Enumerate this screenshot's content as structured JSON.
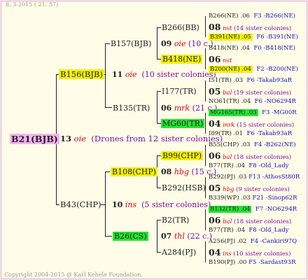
{
  "header": {
    "date": "8,  3-2015  ( 21: 57)"
  },
  "footer": {
    "copyright": "Copyright 2004-2015 @ Karl Kehele Foundation."
  },
  "root": {
    "name": "B21(BJB)",
    "gen": "13",
    "mark": "oie",
    "note": "(Drones from 12 sister colonies)"
  },
  "l1": {
    "top": {
      "name": "B156(BJB)",
      "gen": "11",
      "mark": "oie",
      "note": "(10 sister colonies)"
    },
    "bottom": {
      "name": "B43(CHP)",
      "gen": "10",
      "mark": "ins",
      "note": "(5 sister colonies)"
    }
  },
  "l2": {
    "a": {
      "name": "B157(BJB)",
      "gen": "09",
      "mark": "oie",
      "note": "(10 c.)"
    },
    "b": {
      "name": "B135(TR)",
      "gen": "06",
      "mark": "mrk",
      "note": "(21 c.)"
    },
    "c": {
      "name": "B108(CHP)",
      "gen": "08",
      "mark": "hbg",
      "note": "(15 c.)"
    },
    "d": {
      "name": "B26(CS)",
      "gen": "07",
      "mark": "thl",
      "note": "(22 c.)"
    }
  },
  "l3": {
    "a1": {
      "name": "B266(BB)"
    },
    "a2": {
      "name": "B418(NE)"
    },
    "b1": {
      "name": "I177(TR)"
    },
    "b2": {
      "name": "MG60(TR)"
    },
    "c1": {
      "name": "B99(CHP)"
    },
    "c2": {
      "name": "B292(HSB)"
    },
    "d1": {
      "name": "B2(TR)"
    },
    "d2": {
      "name": "A284(PJ)"
    }
  },
  "l4": {
    "a1": {
      "s": "B266(NE) .06",
      "d": "F3 -B266(NE)",
      "gen": "08",
      "mark": "nst",
      "note": "(14 sister colonies)",
      "m": "B391(NE) .05",
      "md": "F6 -B391(NE)"
    },
    "a2": {
      "s": "B418(NE) .04",
      "d": "F0 -B418(NE)",
      "gen": "06",
      "mark": "nst",
      "note": "",
      "m": "B200(NE) .04",
      "md": "F2 -B200(NE)"
    },
    "b1": {
      "s": "I51(TR) .03",
      "d": "F6 -Takab93aR",
      "gen": "05",
      "mark": "bal",
      "note": "(19 sister colonies)",
      "m": "NO61(TR) .04",
      "md": "F6 -NO6294R"
    },
    "b2": {
      "s": "MG165(TR) .03",
      "d": "F3 -MG00R",
      "gen": "04",
      "mark": "mrk",
      "note": "(15 sister colonies)",
      "m": "I89(TR) .01",
      "md": "F6 -Takab93aR"
    },
    "c1": {
      "s": "B55(CHP) .03",
      "d": "F4 -B262(NE)",
      "gen": "06",
      "mark": "bal",
      "note": "(18 sister colonies)",
      "m": "B77(TR) .04",
      "md": "F8 -Old_Lady"
    },
    "c2": {
      "s": "B292(PJ) .03",
      "d": "F13 -AthosSt80R",
      "gen": "05",
      "mark": "hbg",
      "note": "(9 sister colonies)",
      "m": "B339(WP) .03",
      "md": "F21 -Sinop62R"
    },
    "d1": {
      "s": "B132(TR) .04",
      "d": "F7 -NO6294R",
      "gen": "06",
      "mark": "bal",
      "note": "(18 sister colonies)",
      "m": "B77(TR) .04",
      "md": "F8 -Old_Lady"
    },
    "d2": {
      "s": "A256(PJ) .02",
      "d": "F4 -Cankiri97Q",
      "gen": "04",
      "mark": "ins",
      "note": "(10 sister colonies)",
      "m": "B190(PJ) .00",
      "md": "F5 -Sardast93R"
    }
  }
}
